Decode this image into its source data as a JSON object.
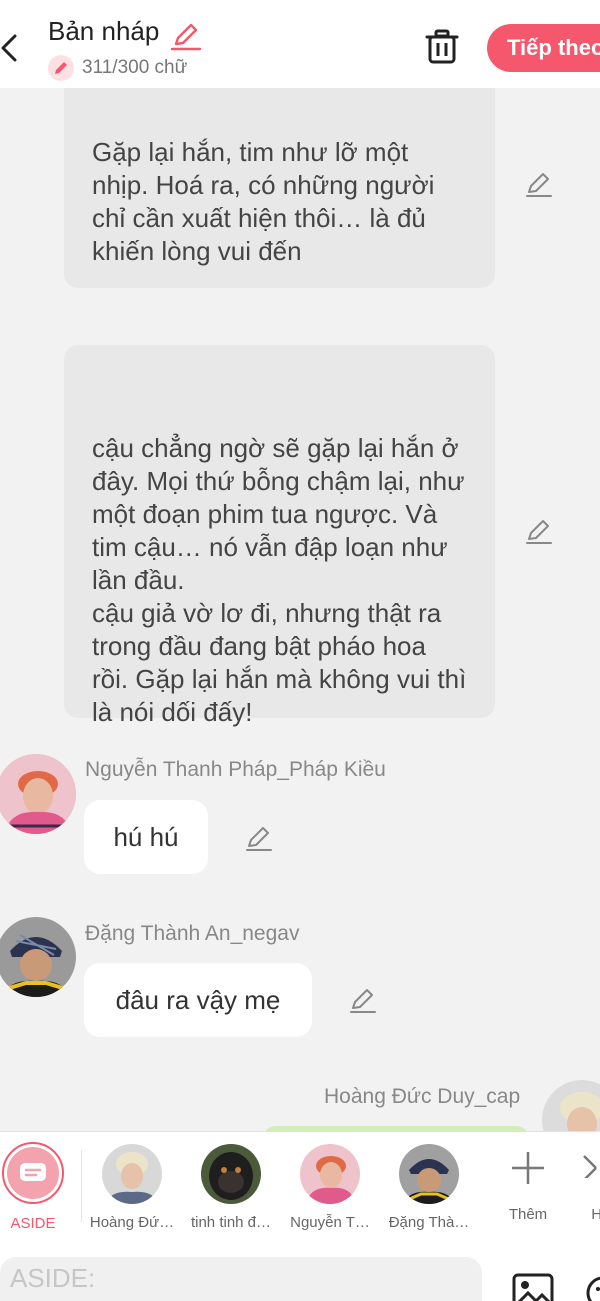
{
  "header": {
    "title": "Bản nháp",
    "word_count": "311/300 chữ",
    "next_label": "Tiếp theo"
  },
  "messages": [
    {
      "type": "narration",
      "text": "Gặp lại hắn, tim như lỡ một nhịp. Hoá ra, có những người chỉ cần xuất hiện thôi… là đủ khiến lòng vui đến"
    },
    {
      "type": "narration",
      "text": "cậu chẳng ngờ sẽ gặp lại hắn ở đây. Mọi thứ bỗng chậm lại, như một đoạn phim tua ngược. Và tim cậu… nó vẫn đập loạn như lần đầu.\ncậu giả vờ lơ đi, nhưng thật ra trong đầu đang bật pháo hoa rồi. Gặp lại hắn mà không vui thì là nói dối đấy!"
    },
    {
      "type": "chat",
      "sender": "Nguyễn Thanh Pháp_Pháp Kiều",
      "text": "hú hú"
    },
    {
      "type": "chat",
      "sender": "Đặng Thành An_negav",
      "text": "đâu ra vậy mẹ"
    },
    {
      "type": "chat-right",
      "sender": "Hoàng Đức Duy_cap",
      "text": ""
    }
  ],
  "characters": [
    {
      "label": "ASIDE"
    },
    {
      "label": "Hoàng Đứ…"
    },
    {
      "label": "tinh tinh đ…"
    },
    {
      "label": "Nguyễn T…"
    },
    {
      "label": "Đặng Thà…"
    },
    {
      "label": "Thêm"
    },
    {
      "label": "Hướng"
    }
  ],
  "input": {
    "placeholder": "ASIDE:"
  },
  "colors": {
    "accent": "#f5576c",
    "bubble": "#e8e8e8",
    "background": "#f2f2f2"
  }
}
